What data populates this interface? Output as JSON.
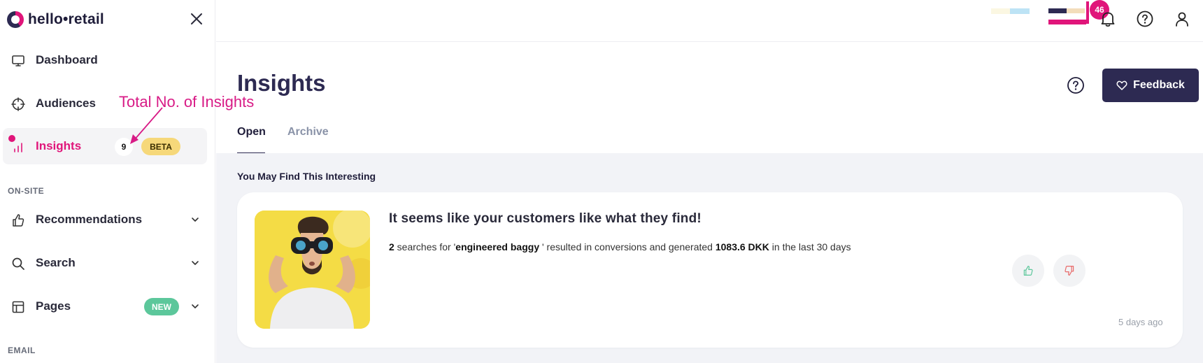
{
  "app": {
    "logo_text": "hello•retail"
  },
  "sidebar": {
    "items": [
      {
        "label": "Dashboard",
        "icon": "monitor-icon"
      },
      {
        "label": "Audiences",
        "icon": "crosshair-icon"
      },
      {
        "label": "Insights",
        "icon": "bar-chart-icon",
        "count": "9",
        "badge": "BETA",
        "active": true
      },
      {
        "label": "Recommendations",
        "icon": "thumbs-up-icon"
      },
      {
        "label": "Search",
        "icon": "search-icon"
      },
      {
        "label": "Pages",
        "icon": "layout-icon",
        "badge": "NEW"
      }
    ],
    "section_onsite": "ON-SITE",
    "section_email": "EMAIL"
  },
  "annotation": {
    "text": "Total No. of Insights",
    "color": "#d81b86"
  },
  "topbar": {
    "notification_count": "46"
  },
  "header": {
    "title": "Insights",
    "feedback_label": "Feedback"
  },
  "tabs": [
    {
      "label": "Open",
      "active": true
    },
    {
      "label": "Archive",
      "active": false
    }
  ],
  "content": {
    "section_heading": "You May Find This Interesting",
    "card": {
      "title": "It seems like your customers like what they find!",
      "desc_count": "2",
      "desc_part1": " searches for '",
      "desc_term": "engineered baggy",
      "desc_part2": " ' resulted in conversions and generated ",
      "desc_amount": "1083.6 DKK",
      "desc_part3": " in the last 30 days",
      "time_ago": "5 days ago"
    }
  },
  "colors": {
    "brand_dark": "#2d2a52",
    "brand_pink": "#e0157a",
    "beta": "#f6d87a",
    "new": "#5cc79b",
    "image_bg": "#f4dc45"
  }
}
